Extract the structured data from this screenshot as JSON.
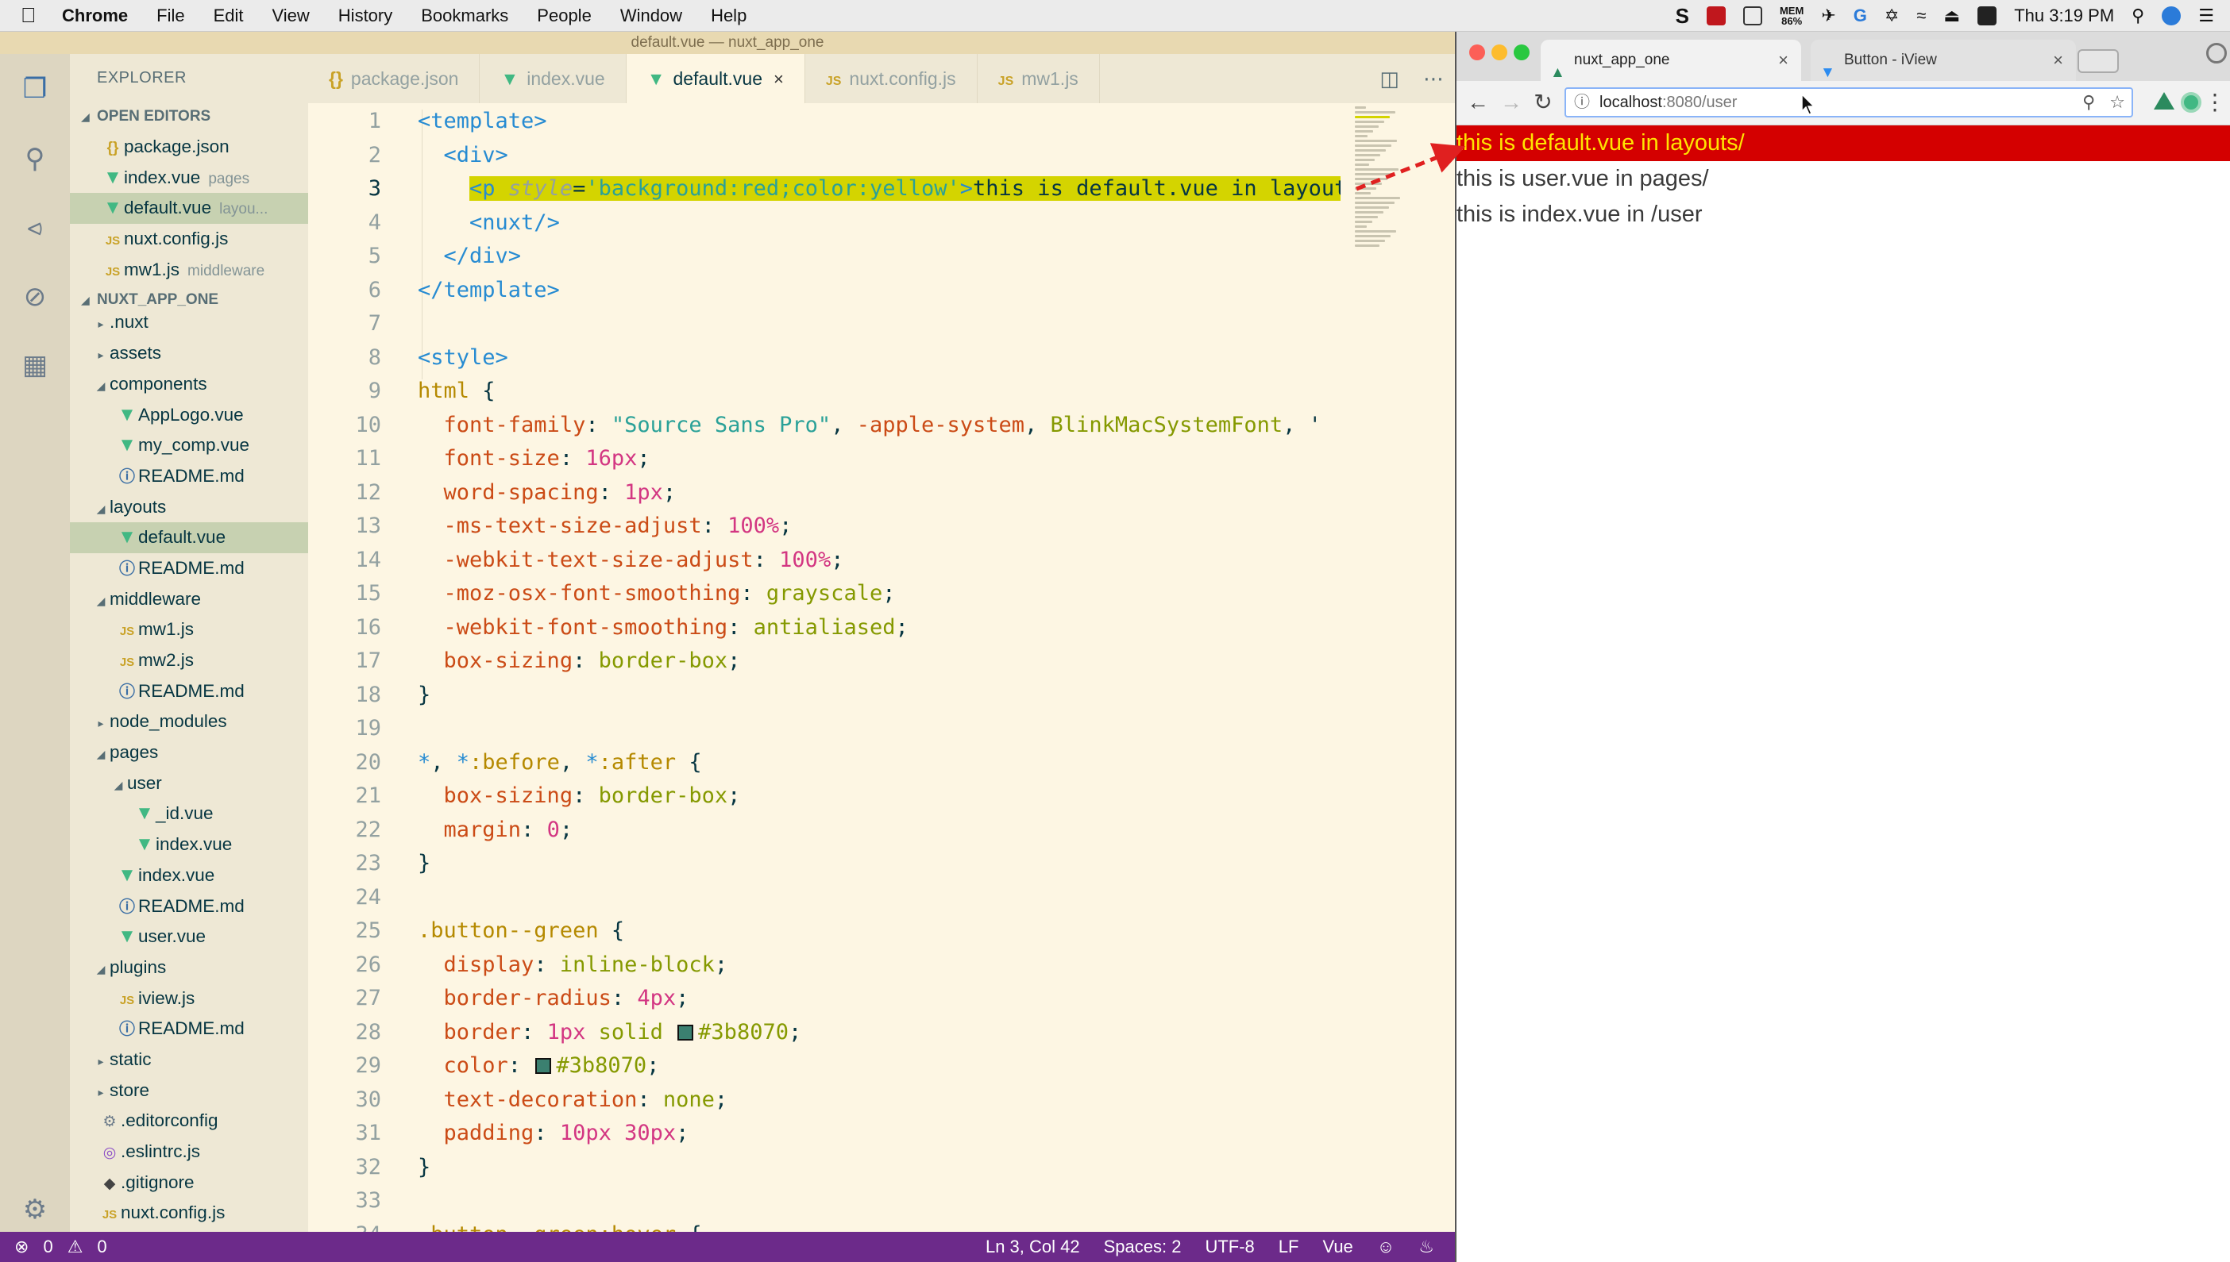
{
  "menubar": {
    "app_name": "Chrome",
    "items": [
      "File",
      "Edit",
      "View",
      "History",
      "Bookmarks",
      "People",
      "Window",
      "Help"
    ],
    "mem_label": "MEM",
    "mem_value": "86%",
    "clock": "Thu 3:19 PM"
  },
  "vscode": {
    "window_title": "default.vue — nuxt_app_one",
    "explorer_title": "EXPLORER",
    "open_editors_header": "OPEN EDITORS",
    "open_editors": [
      {
        "name": "package.json",
        "desc": "",
        "icon": "json-icon"
      },
      {
        "name": "index.vue",
        "desc": "pages",
        "icon": "vue-icon"
      },
      {
        "name": "default.vue",
        "desc": "layou...",
        "icon": "vue-icon"
      },
      {
        "name": "nuxt.config.js",
        "desc": "",
        "icon": "js-icon"
      },
      {
        "name": "mw1.js",
        "desc": "middleware",
        "icon": "js-icon"
      }
    ],
    "project_header": "NUXT_APP_ONE",
    "tree": [
      {
        "name": ".nuxt",
        "type": "folder-collapsed",
        "depth": 0
      },
      {
        "name": "assets",
        "type": "folder-collapsed",
        "depth": 0
      },
      {
        "name": "components",
        "type": "folder-open",
        "depth": 0
      },
      {
        "name": "AppLogo.vue",
        "type": "vue",
        "depth": 1
      },
      {
        "name": "my_comp.vue",
        "type": "vue",
        "depth": 1
      },
      {
        "name": "README.md",
        "type": "info",
        "depth": 1
      },
      {
        "name": "layouts",
        "type": "folder-open",
        "depth": 0
      },
      {
        "name": "default.vue",
        "type": "vue",
        "depth": 1,
        "selected": true
      },
      {
        "name": "README.md",
        "type": "info",
        "depth": 1
      },
      {
        "name": "middleware",
        "type": "folder-open",
        "depth": 0
      },
      {
        "name": "mw1.js",
        "type": "js",
        "depth": 1
      },
      {
        "name": "mw2.js",
        "type": "js",
        "depth": 1
      },
      {
        "name": "README.md",
        "type": "info",
        "depth": 1
      },
      {
        "name": "node_modules",
        "type": "folder-collapsed",
        "depth": 0
      },
      {
        "name": "pages",
        "type": "folder-open",
        "depth": 0
      },
      {
        "name": "user",
        "type": "folder-open",
        "depth": 1
      },
      {
        "name": "_id.vue",
        "type": "vue",
        "depth": 2
      },
      {
        "name": "index.vue",
        "type": "vue",
        "depth": 2
      },
      {
        "name": "index.vue",
        "type": "vue",
        "depth": 1
      },
      {
        "name": "README.md",
        "type": "info",
        "depth": 1
      },
      {
        "name": "user.vue",
        "type": "vue",
        "depth": 1
      },
      {
        "name": "plugins",
        "type": "folder-open",
        "depth": 0
      },
      {
        "name": "iview.js",
        "type": "js",
        "depth": 1
      },
      {
        "name": "README.md",
        "type": "info",
        "depth": 1
      },
      {
        "name": "static",
        "type": "folder-collapsed",
        "depth": 0
      },
      {
        "name": "store",
        "type": "folder-collapsed",
        "depth": 0
      },
      {
        "name": ".editorconfig",
        "type": "gear",
        "depth": 0
      },
      {
        "name": ".eslintrc.js",
        "type": "eslint",
        "depth": 0
      },
      {
        "name": ".gitignore",
        "type": "git",
        "depth": 0
      },
      {
        "name": "nuxt.config.js",
        "type": "js",
        "depth": 0
      }
    ],
    "tabs": [
      {
        "label": "package.json",
        "icon": "json-icon",
        "active": false
      },
      {
        "label": "index.vue",
        "icon": "vue-icon",
        "active": false
      },
      {
        "label": "default.vue",
        "icon": "vue-icon",
        "active": true
      },
      {
        "label": "nuxt.config.js",
        "icon": "js-icon",
        "active": false
      },
      {
        "label": "mw1.js",
        "icon": "js-icon",
        "active": false
      }
    ],
    "code_lines": [
      {
        "n": "1",
        "tokens": [
          [
            "t-tag",
            "<template>"
          ]
        ]
      },
      {
        "n": "2",
        "tokens": [
          [
            "t-punc",
            "  "
          ],
          [
            "t-tag",
            "<div>"
          ]
        ]
      },
      {
        "n": "3",
        "hl": true,
        "tokens": [
          [
            "t-punc",
            "    "
          ],
          [
            "t-tag",
            "<p"
          ],
          [
            "t-punc",
            " "
          ],
          [
            "t-attr",
            "style"
          ],
          [
            "t-punc",
            "="
          ],
          [
            "t-str",
            "'background:red;color:yellow'"
          ],
          [
            "t-tag",
            ">"
          ],
          [
            "t-punc",
            "this is default.vue in layouts/"
          ]
        ]
      },
      {
        "n": "4",
        "tokens": [
          [
            "t-punc",
            "    "
          ],
          [
            "t-tag",
            "<nuxt/>"
          ]
        ]
      },
      {
        "n": "5",
        "tokens": [
          [
            "t-punc",
            "  "
          ],
          [
            "t-tag",
            "</div>"
          ]
        ]
      },
      {
        "n": "6",
        "tokens": [
          [
            "t-tag",
            "</template>"
          ]
        ]
      },
      {
        "n": "7",
        "tokens": []
      },
      {
        "n": "8",
        "tokens": [
          [
            "t-tag",
            "<style>"
          ]
        ]
      },
      {
        "n": "9",
        "tokens": [
          [
            "t-sel",
            "html"
          ],
          [
            "t-punc",
            " {"
          ]
        ]
      },
      {
        "n": "10",
        "tokens": [
          [
            "t-punc",
            "  "
          ],
          [
            "t-prop2",
            "font-family"
          ],
          [
            "t-punc",
            ": "
          ],
          [
            "t-str",
            "\"Source Sans Pro\""
          ],
          [
            "t-punc",
            ", "
          ],
          [
            "t-prop2",
            "-apple-system"
          ],
          [
            "t-punc",
            ", "
          ],
          [
            "t-kw",
            "BlinkMacSystemFont"
          ],
          [
            "t-punc",
            ", '"
          ]
        ]
      },
      {
        "n": "11",
        "tokens": [
          [
            "t-punc",
            "  "
          ],
          [
            "t-prop2",
            "font-size"
          ],
          [
            "t-punc",
            ": "
          ],
          [
            "t-num",
            "16px"
          ],
          [
            "t-punc",
            ";"
          ]
        ]
      },
      {
        "n": "12",
        "tokens": [
          [
            "t-punc",
            "  "
          ],
          [
            "t-prop2",
            "word-spacing"
          ],
          [
            "t-punc",
            ": "
          ],
          [
            "t-num",
            "1px"
          ],
          [
            "t-punc",
            ";"
          ]
        ]
      },
      {
        "n": "13",
        "tokens": [
          [
            "t-punc",
            "  "
          ],
          [
            "t-prop2",
            "-ms-text-size-adjust"
          ],
          [
            "t-punc",
            ": "
          ],
          [
            "t-num",
            "100%"
          ],
          [
            "t-punc",
            ";"
          ]
        ]
      },
      {
        "n": "14",
        "tokens": [
          [
            "t-punc",
            "  "
          ],
          [
            "t-prop2",
            "-webkit-text-size-adjust"
          ],
          [
            "t-punc",
            ": "
          ],
          [
            "t-num",
            "100%"
          ],
          [
            "t-punc",
            ";"
          ]
        ]
      },
      {
        "n": "15",
        "tokens": [
          [
            "t-punc",
            "  "
          ],
          [
            "t-prop2",
            "-moz-osx-font-smoothing"
          ],
          [
            "t-punc",
            ": "
          ],
          [
            "t-kw",
            "grayscale"
          ],
          [
            "t-punc",
            ";"
          ]
        ]
      },
      {
        "n": "16",
        "tokens": [
          [
            "t-punc",
            "  "
          ],
          [
            "t-prop2",
            "-webkit-font-smoothing"
          ],
          [
            "t-punc",
            ": "
          ],
          [
            "t-kw",
            "antialiased"
          ],
          [
            "t-punc",
            ";"
          ]
        ]
      },
      {
        "n": "17",
        "tokens": [
          [
            "t-punc",
            "  "
          ],
          [
            "t-prop2",
            "box-sizing"
          ],
          [
            "t-punc",
            ": "
          ],
          [
            "t-kw",
            "border-box"
          ],
          [
            "t-punc",
            ";"
          ]
        ]
      },
      {
        "n": "18",
        "tokens": [
          [
            "t-punc",
            "}"
          ]
        ]
      },
      {
        "n": "19",
        "tokens": []
      },
      {
        "n": "20",
        "tokens": [
          [
            "t-tag",
            "*"
          ],
          [
            "t-punc",
            ", "
          ],
          [
            "t-tag",
            "*"
          ],
          [
            "t-sel",
            ":before"
          ],
          [
            "t-punc",
            ", "
          ],
          [
            "t-tag",
            "*"
          ],
          [
            "t-sel",
            ":after"
          ],
          [
            "t-punc",
            " {"
          ]
        ]
      },
      {
        "n": "21",
        "tokens": [
          [
            "t-punc",
            "  "
          ],
          [
            "t-prop2",
            "box-sizing"
          ],
          [
            "t-punc",
            ": "
          ],
          [
            "t-kw",
            "border-box"
          ],
          [
            "t-punc",
            ";"
          ]
        ]
      },
      {
        "n": "22",
        "tokens": [
          [
            "t-punc",
            "  "
          ],
          [
            "t-prop2",
            "margin"
          ],
          [
            "t-punc",
            ": "
          ],
          [
            "t-num",
            "0"
          ],
          [
            "t-punc",
            ";"
          ]
        ]
      },
      {
        "n": "23",
        "tokens": [
          [
            "t-punc",
            "}"
          ]
        ]
      },
      {
        "n": "24",
        "tokens": []
      },
      {
        "n": "25",
        "tokens": [
          [
            "t-sel",
            ".button--green"
          ],
          [
            "t-punc",
            " {"
          ]
        ]
      },
      {
        "n": "26",
        "tokens": [
          [
            "t-punc",
            "  "
          ],
          [
            "t-prop2",
            "display"
          ],
          [
            "t-punc",
            ": "
          ],
          [
            "t-kw",
            "inline-block"
          ],
          [
            "t-punc",
            ";"
          ]
        ]
      },
      {
        "n": "27",
        "tokens": [
          [
            "t-punc",
            "  "
          ],
          [
            "t-prop2",
            "border-radius"
          ],
          [
            "t-punc",
            ": "
          ],
          [
            "t-num",
            "4px"
          ],
          [
            "t-punc",
            ";"
          ]
        ]
      },
      {
        "n": "28",
        "tokens": [
          [
            "t-punc",
            "  "
          ],
          [
            "t-prop2",
            "border"
          ],
          [
            "t-punc",
            ": "
          ],
          [
            "t-num",
            "1px"
          ],
          [
            "t-punc",
            " "
          ],
          [
            "t-kw",
            "solid"
          ],
          [
            "t-punc",
            " "
          ],
          [
            "swatch",
            "#3b8070"
          ],
          [
            "t-kw",
            "#3b8070"
          ],
          [
            "t-punc",
            ";"
          ]
        ]
      },
      {
        "n": "29",
        "tokens": [
          [
            "t-punc",
            "  "
          ],
          [
            "t-prop2",
            "color"
          ],
          [
            "t-punc",
            ": "
          ],
          [
            "swatch",
            "#3b8070"
          ],
          [
            "t-kw",
            "#3b8070"
          ],
          [
            "t-punc",
            ";"
          ]
        ]
      },
      {
        "n": "30",
        "tokens": [
          [
            "t-punc",
            "  "
          ],
          [
            "t-prop2",
            "text-decoration"
          ],
          [
            "t-punc",
            ": "
          ],
          [
            "t-kw",
            "none"
          ],
          [
            "t-punc",
            ";"
          ]
        ]
      },
      {
        "n": "31",
        "tokens": [
          [
            "t-punc",
            "  "
          ],
          [
            "t-prop2",
            "padding"
          ],
          [
            "t-punc",
            ": "
          ],
          [
            "t-num",
            "10px"
          ],
          [
            "t-punc",
            " "
          ],
          [
            "t-num",
            "30px"
          ],
          [
            "t-punc",
            ";"
          ]
        ]
      },
      {
        "n": "32",
        "tokens": [
          [
            "t-punc",
            "}"
          ]
        ]
      },
      {
        "n": "33",
        "tokens": []
      },
      {
        "n": "34",
        "tokens": [
          [
            "t-sel",
            ".button--green:hover"
          ],
          [
            "t-punc",
            " {"
          ]
        ]
      }
    ],
    "current_line": "3",
    "status": {
      "errors": "0",
      "warnings": "0",
      "position": "Ln 3, Col 42",
      "spaces": "Spaces: 2",
      "encoding": "UTF-8",
      "eol": "LF",
      "language": "Vue"
    }
  },
  "chrome": {
    "tabs": [
      {
        "title": "nuxt_app_one",
        "favicon": "nuxt-icon",
        "active": true
      },
      {
        "title": "Button - iView",
        "favicon": "iview-icon",
        "active": false
      }
    ],
    "url_host": "localhost",
    "url_path": ":8080/user",
    "page_lines": [
      {
        "text": "this is default.vue in layouts/",
        "style": "default"
      },
      {
        "text": "this is user.vue in pages/",
        "style": "normal"
      },
      {
        "text": "this is index.vue in /user",
        "style": "normal"
      }
    ]
  },
  "colors": {
    "vs_bg": "#fdf6e3",
    "vs_sidebar": "#eee8d5",
    "vs_status": "#6c2a8a",
    "highlight": "#d4d400",
    "page_red": "#d40000",
    "page_yellow": "#ffe400",
    "arrow": "#e02020"
  }
}
